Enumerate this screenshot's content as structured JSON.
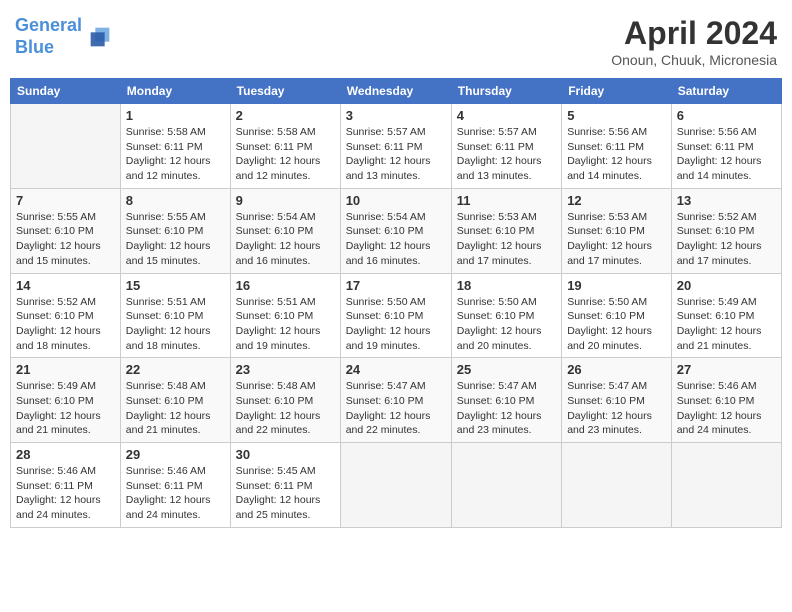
{
  "header": {
    "logo_line1": "General",
    "logo_line2": "Blue",
    "title": "April 2024",
    "subtitle": "Onoun, Chuuk, Micronesia"
  },
  "days_of_week": [
    "Sunday",
    "Monday",
    "Tuesday",
    "Wednesday",
    "Thursday",
    "Friday",
    "Saturday"
  ],
  "weeks": [
    [
      {
        "day": null,
        "info": null
      },
      {
        "day": "1",
        "info": "Sunrise: 5:58 AM\nSunset: 6:11 PM\nDaylight: 12 hours\nand 12 minutes."
      },
      {
        "day": "2",
        "info": "Sunrise: 5:58 AM\nSunset: 6:11 PM\nDaylight: 12 hours\nand 12 minutes."
      },
      {
        "day": "3",
        "info": "Sunrise: 5:57 AM\nSunset: 6:11 PM\nDaylight: 12 hours\nand 13 minutes."
      },
      {
        "day": "4",
        "info": "Sunrise: 5:57 AM\nSunset: 6:11 PM\nDaylight: 12 hours\nand 13 minutes."
      },
      {
        "day": "5",
        "info": "Sunrise: 5:56 AM\nSunset: 6:11 PM\nDaylight: 12 hours\nand 14 minutes."
      },
      {
        "day": "6",
        "info": "Sunrise: 5:56 AM\nSunset: 6:11 PM\nDaylight: 12 hours\nand 14 minutes."
      }
    ],
    [
      {
        "day": "7",
        "info": "Sunrise: 5:55 AM\nSunset: 6:10 PM\nDaylight: 12 hours\nand 15 minutes."
      },
      {
        "day": "8",
        "info": "Sunrise: 5:55 AM\nSunset: 6:10 PM\nDaylight: 12 hours\nand 15 minutes."
      },
      {
        "day": "9",
        "info": "Sunrise: 5:54 AM\nSunset: 6:10 PM\nDaylight: 12 hours\nand 16 minutes."
      },
      {
        "day": "10",
        "info": "Sunrise: 5:54 AM\nSunset: 6:10 PM\nDaylight: 12 hours\nand 16 minutes."
      },
      {
        "day": "11",
        "info": "Sunrise: 5:53 AM\nSunset: 6:10 PM\nDaylight: 12 hours\nand 17 minutes."
      },
      {
        "day": "12",
        "info": "Sunrise: 5:53 AM\nSunset: 6:10 PM\nDaylight: 12 hours\nand 17 minutes."
      },
      {
        "day": "13",
        "info": "Sunrise: 5:52 AM\nSunset: 6:10 PM\nDaylight: 12 hours\nand 17 minutes."
      }
    ],
    [
      {
        "day": "14",
        "info": "Sunrise: 5:52 AM\nSunset: 6:10 PM\nDaylight: 12 hours\nand 18 minutes."
      },
      {
        "day": "15",
        "info": "Sunrise: 5:51 AM\nSunset: 6:10 PM\nDaylight: 12 hours\nand 18 minutes."
      },
      {
        "day": "16",
        "info": "Sunrise: 5:51 AM\nSunset: 6:10 PM\nDaylight: 12 hours\nand 19 minutes."
      },
      {
        "day": "17",
        "info": "Sunrise: 5:50 AM\nSunset: 6:10 PM\nDaylight: 12 hours\nand 19 minutes."
      },
      {
        "day": "18",
        "info": "Sunrise: 5:50 AM\nSunset: 6:10 PM\nDaylight: 12 hours\nand 20 minutes."
      },
      {
        "day": "19",
        "info": "Sunrise: 5:50 AM\nSunset: 6:10 PM\nDaylight: 12 hours\nand 20 minutes."
      },
      {
        "day": "20",
        "info": "Sunrise: 5:49 AM\nSunset: 6:10 PM\nDaylight: 12 hours\nand 21 minutes."
      }
    ],
    [
      {
        "day": "21",
        "info": "Sunrise: 5:49 AM\nSunset: 6:10 PM\nDaylight: 12 hours\nand 21 minutes."
      },
      {
        "day": "22",
        "info": "Sunrise: 5:48 AM\nSunset: 6:10 PM\nDaylight: 12 hours\nand 21 minutes."
      },
      {
        "day": "23",
        "info": "Sunrise: 5:48 AM\nSunset: 6:10 PM\nDaylight: 12 hours\nand 22 minutes."
      },
      {
        "day": "24",
        "info": "Sunrise: 5:47 AM\nSunset: 6:10 PM\nDaylight: 12 hours\nand 22 minutes."
      },
      {
        "day": "25",
        "info": "Sunrise: 5:47 AM\nSunset: 6:10 PM\nDaylight: 12 hours\nand 23 minutes."
      },
      {
        "day": "26",
        "info": "Sunrise: 5:47 AM\nSunset: 6:10 PM\nDaylight: 12 hours\nand 23 minutes."
      },
      {
        "day": "27",
        "info": "Sunrise: 5:46 AM\nSunset: 6:10 PM\nDaylight: 12 hours\nand 24 minutes."
      }
    ],
    [
      {
        "day": "28",
        "info": "Sunrise: 5:46 AM\nSunset: 6:11 PM\nDaylight: 12 hours\nand 24 minutes."
      },
      {
        "day": "29",
        "info": "Sunrise: 5:46 AM\nSunset: 6:11 PM\nDaylight: 12 hours\nand 24 minutes."
      },
      {
        "day": "30",
        "info": "Sunrise: 5:45 AM\nSunset: 6:11 PM\nDaylight: 12 hours\nand 25 minutes."
      },
      {
        "day": null,
        "info": null
      },
      {
        "day": null,
        "info": null
      },
      {
        "day": null,
        "info": null
      },
      {
        "day": null,
        "info": null
      }
    ]
  ]
}
